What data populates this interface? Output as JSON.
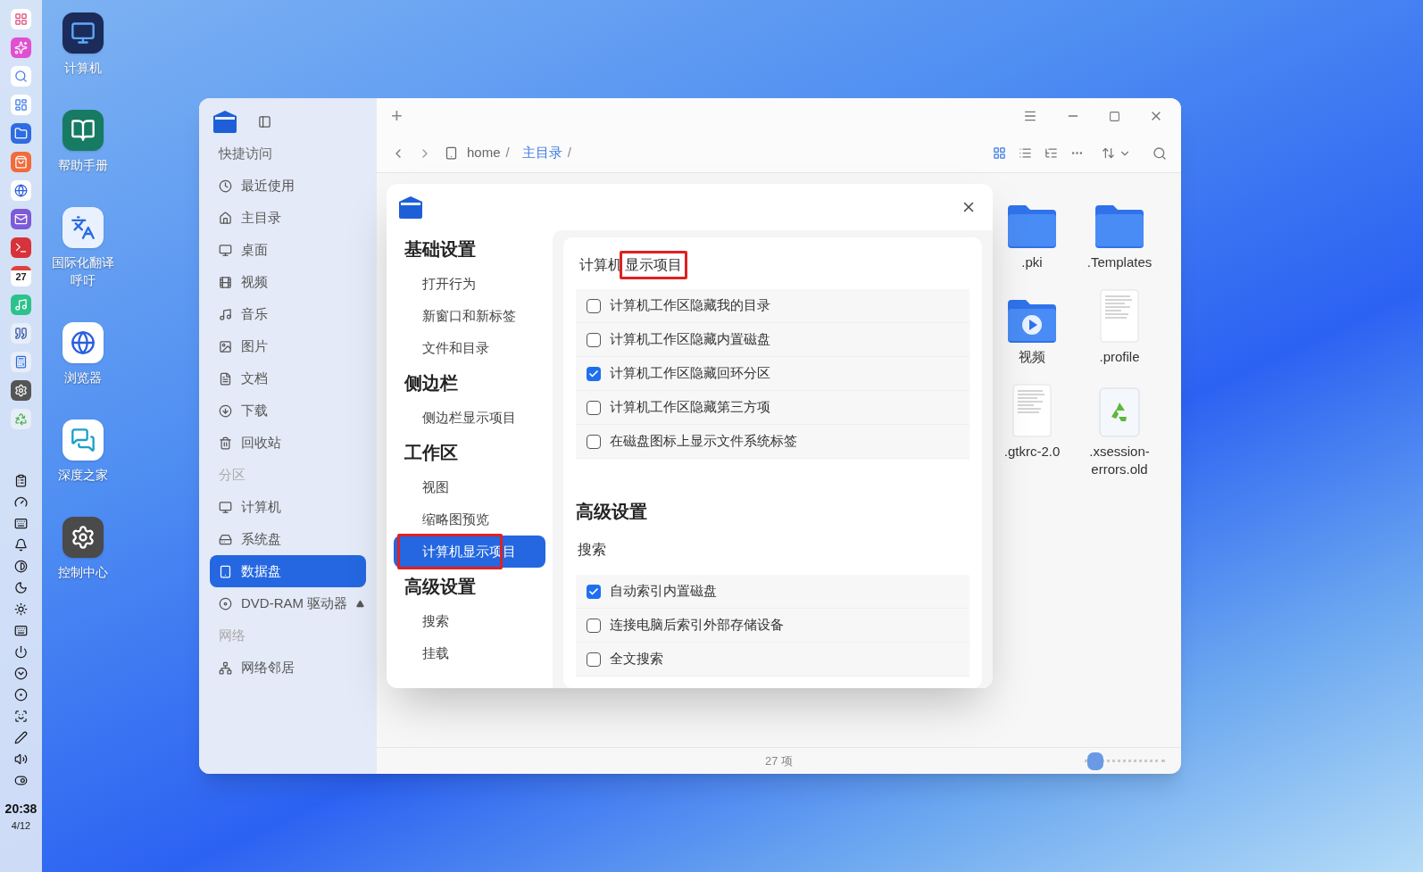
{
  "dock": {
    "calendar_day": "27",
    "clock": {
      "time": "20:38",
      "date": "4/12"
    }
  },
  "desktop_icons": [
    {
      "label": "计算机"
    },
    {
      "label": "帮助手册"
    },
    {
      "label": "国际化翻译呼吁"
    },
    {
      "label": "浏览器"
    },
    {
      "label": "深度之家"
    },
    {
      "label": "控制中心"
    }
  ],
  "file_manager": {
    "sidebar": {
      "sections": [
        {
          "title": "快捷访问",
          "items": [
            {
              "label": "最近使用",
              "selected": false
            },
            {
              "label": "主目录",
              "selected": false
            },
            {
              "label": "桌面",
              "selected": false
            },
            {
              "label": "视频",
              "selected": false
            },
            {
              "label": "音乐",
              "selected": false
            },
            {
              "label": "图片",
              "selected": false
            },
            {
              "label": "文档",
              "selected": false
            },
            {
              "label": "下载",
              "selected": false
            },
            {
              "label": "回收站",
              "selected": false
            }
          ]
        },
        {
          "title": "分区",
          "items": [
            {
              "label": "计算机",
              "selected": false
            },
            {
              "label": "系统盘",
              "selected": false
            },
            {
              "label": "数据盘",
              "selected": true
            },
            {
              "label": "DVD-RAM 驱动器",
              "selected": false,
              "ejectable": true
            }
          ]
        },
        {
          "title": "网络",
          "items": [
            {
              "label": "网络邻居",
              "selected": false
            }
          ]
        }
      ]
    },
    "tab_bar": {
      "new_tab": "+"
    },
    "breadcrumb": [
      {
        "text": "home",
        "sep": "/",
        "selected": false
      },
      {
        "text": "主目录",
        "sep": "/",
        "selected": true
      }
    ],
    "view_modes": [
      {
        "kind": "icons",
        "selected": true
      },
      {
        "kind": "list",
        "selected": false
      },
      {
        "kind": "tree",
        "selected": false
      },
      {
        "kind": "more",
        "selected": false
      }
    ],
    "files": [
      {
        "name": ".pki",
        "kind": "folder"
      },
      {
        "name": ".Templates",
        "kind": "folder"
      },
      {
        "name": "视频",
        "kind": "video-folder"
      },
      {
        "name": ".profile",
        "kind": "text"
      },
      {
        "name": ".gtkrc-2.0",
        "kind": "text"
      },
      {
        "name": ".xsession-errors.old",
        "kind": "recycle"
      }
    ],
    "status_bar": {
      "count": "27 项",
      "zoom": {
        "level": 0.04
      }
    }
  },
  "settings_dialog": {
    "nav": [
      {
        "title": "基础设置",
        "items": [
          {
            "label": "打开行为",
            "selected": false,
            "highlighted": false
          },
          {
            "label": "新窗口和新标签",
            "selected": false,
            "highlighted": false
          },
          {
            "label": "文件和目录",
            "selected": false,
            "highlighted": false
          }
        ]
      },
      {
        "title": "侧边栏",
        "items": [
          {
            "label": "侧边栏显示项目",
            "selected": false,
            "highlighted": false
          }
        ]
      },
      {
        "title": "工作区",
        "items": [
          {
            "label": "视图",
            "selected": false,
            "highlighted": false
          },
          {
            "label": "缩略图预览",
            "selected": false,
            "highlighted": false
          },
          {
            "label": "计算机显示项目",
            "selected": true,
            "highlighted": true
          }
        ]
      },
      {
        "title": "高级设置",
        "items": [
          {
            "label": "搜索",
            "selected": false,
            "highlighted": false
          },
          {
            "label": "挂载",
            "selected": false,
            "highlighted": false
          }
        ]
      }
    ],
    "group": {
      "title_parts": [
        {
          "text": "计算机",
          "highlighted": false
        },
        {
          "text": "显示项目",
          "highlighted": true
        }
      ],
      "options": [
        {
          "label": "计算机工作区隐藏我的目录",
          "checked": false
        },
        {
          "label": "计算机工作区隐藏内置磁盘",
          "checked": false
        },
        {
          "label": "计算机工作区隐藏回环分区",
          "checked": true
        },
        {
          "label": "计算机工作区隐藏第三方项",
          "checked": false
        },
        {
          "label": "在磁盘图标上显示文件系统标签",
          "checked": false
        }
      ]
    },
    "section": {
      "title": "高级设置",
      "subtitle": "搜索",
      "options": [
        {
          "label": "自动索引内置磁盘",
          "checked": true
        },
        {
          "label": "连接电脑后索引外部存储设备",
          "checked": false
        },
        {
          "label": "全文搜索",
          "checked": false
        }
      ]
    }
  }
}
